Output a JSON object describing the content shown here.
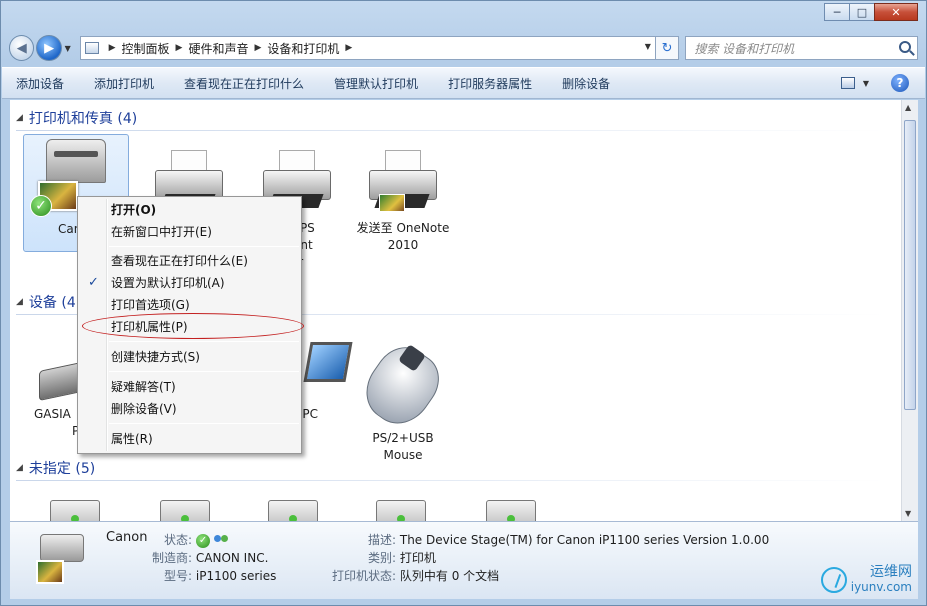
{
  "window": {
    "caption_buttons": [
      "─",
      "□",
      "✕"
    ]
  },
  "nav": {
    "back_icon": "back-arrow-icon",
    "forward_icon": "forward-arrow-icon",
    "breadcrumb": [
      "控制面板",
      "硬件和声音",
      "设备和打印机"
    ],
    "search_placeholder": "搜索 设备和打印机"
  },
  "toolbar": {
    "items": [
      "添加设备",
      "添加打印机",
      "查看现在正在打印什么",
      "管理默认打印机",
      "打印服务器属性",
      "删除设备"
    ]
  },
  "sections": {
    "printers": {
      "title": "打印机和传真 (4)"
    },
    "devices": {
      "title": "设备 (4"
    },
    "unspecified": {
      "title": "未指定 (5)"
    }
  },
  "printers": [
    {
      "label": "Can"
    },
    {
      "label": ""
    },
    {
      "label_lines": [
        "ft XPS",
        "ment",
        "er"
      ]
    },
    {
      "label_lines": [
        "发送至 OneNote",
        "2010"
      ]
    }
  ],
  "devices": [
    {
      "label_lines": [
        "GASIA",
        "Pr"
      ]
    },
    {
      "label": "-PC"
    },
    {
      "label_lines": [
        "PS/2+USB",
        "Mouse"
      ]
    }
  ],
  "context_menu": {
    "items": [
      {
        "label": "打开(O)",
        "bold": true
      },
      {
        "label": "在新窗口中打开(E)"
      },
      {
        "label": "查看现在正在打印什么(E)"
      },
      {
        "label": "设置为默认打印机(A)",
        "checked": true
      },
      {
        "label": "打印首选项(G)"
      },
      {
        "label": "打印机属性(P)",
        "highlighted": true
      },
      {
        "label": "创建快捷方式(S)"
      },
      {
        "label": "疑难解答(T)"
      },
      {
        "label": "删除设备(V)"
      },
      {
        "label": "属性(R)"
      }
    ]
  },
  "details": {
    "name": "Canon",
    "status_label": "状态:",
    "manufacturer_label": "制造商:",
    "manufacturer": "CANON INC.",
    "model_label": "型号:",
    "model": "iP1100 series",
    "description_label": "描述:",
    "description": "The Device Stage(TM) for Canon iP1100 series Version 1.0.00",
    "category_label": "类别:",
    "category": "打印机",
    "printer_status_label": "打印机状态:",
    "printer_status": "队列中有 0 个文档"
  },
  "watermark": {
    "cn": "运维网",
    "en": "iyunv.com"
  },
  "colors": {
    "section_header": "#1e3f9a",
    "context_highlight_ellipse": "#c32020"
  }
}
